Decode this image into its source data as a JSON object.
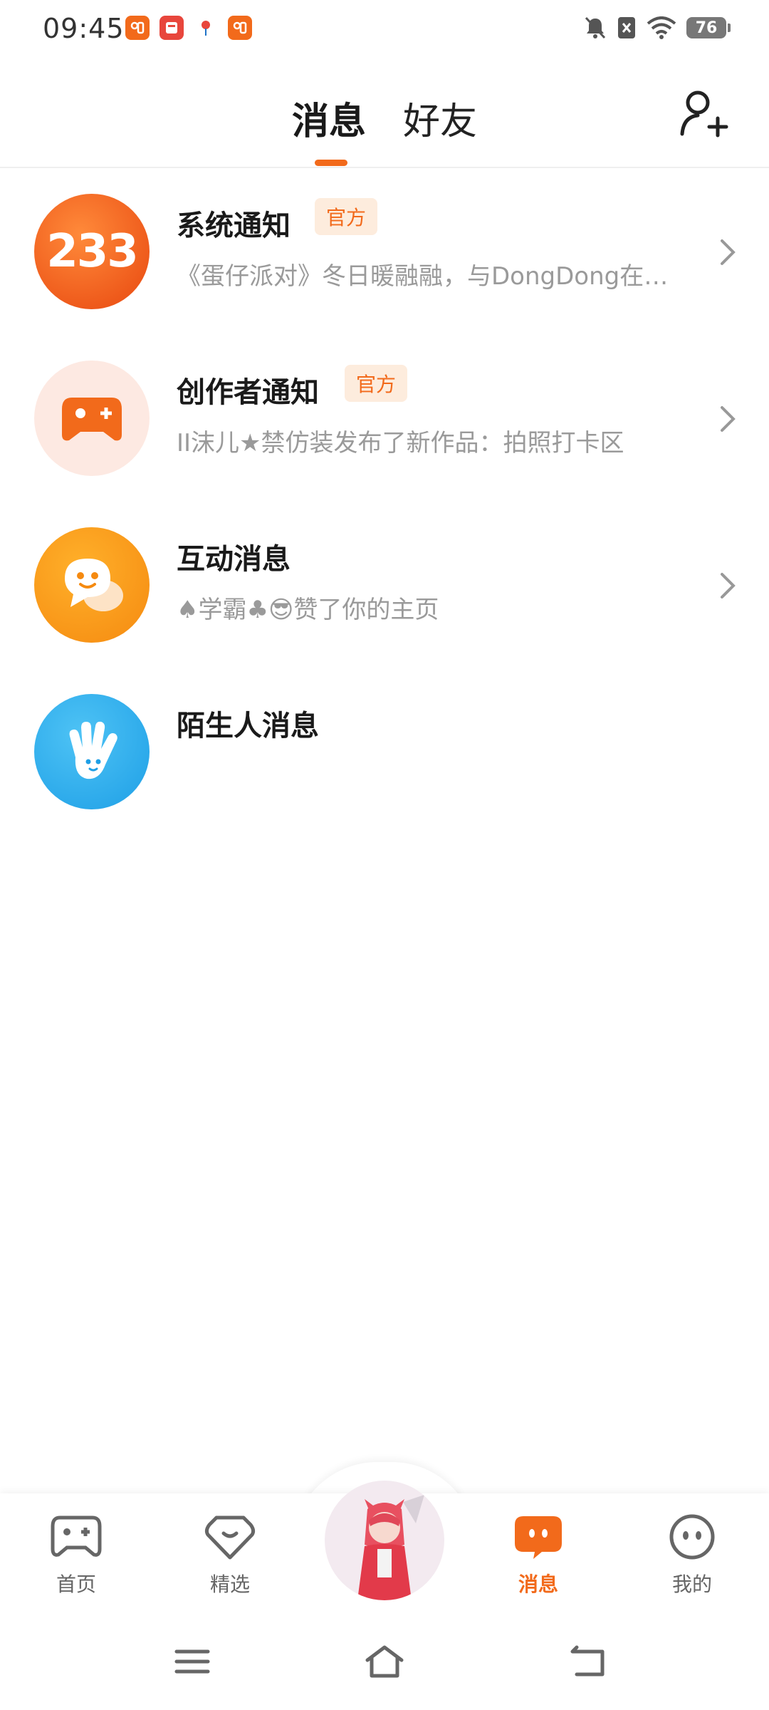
{
  "status_bar": {
    "time": "09:45",
    "battery": "76"
  },
  "header": {
    "tabs": [
      {
        "label": "消息",
        "active": true
      },
      {
        "label": "好友",
        "active": false
      }
    ]
  },
  "messages": [
    {
      "title": "系统通知",
      "badge": "官方",
      "preview": "《蛋仔派对》冬日暖融融，与DongDong在…",
      "icon": "233-logo-icon",
      "icon_text": "233"
    },
    {
      "title": "创作者通知",
      "badge": "官方",
      "preview": "II沫儿★禁仿装发布了新作品：拍照打卡区",
      "icon": "gamepad-icon"
    },
    {
      "title": "互动消息",
      "preview": "♠学霸♣😎赞了你的主页",
      "icon": "chat-bubble-face-icon"
    },
    {
      "title": "陌生人消息",
      "icon": "waving-hand-icon"
    }
  ],
  "bottom_nav": [
    {
      "label": "首页",
      "icon": "gamepad-icon",
      "active": false
    },
    {
      "label": "精选",
      "icon": "heart-diamond-icon",
      "active": false
    },
    {
      "label": "",
      "icon": "user-avatar",
      "active": false
    },
    {
      "label": "消息",
      "icon": "message-icon",
      "active": true
    },
    {
      "label": "我的",
      "icon": "face-icon",
      "active": false
    }
  ],
  "colors": {
    "accent": "#f26a1b",
    "muted": "#9a9a9a",
    "badge_bg": "#fdecdd",
    "blue": "#29a8ec"
  }
}
